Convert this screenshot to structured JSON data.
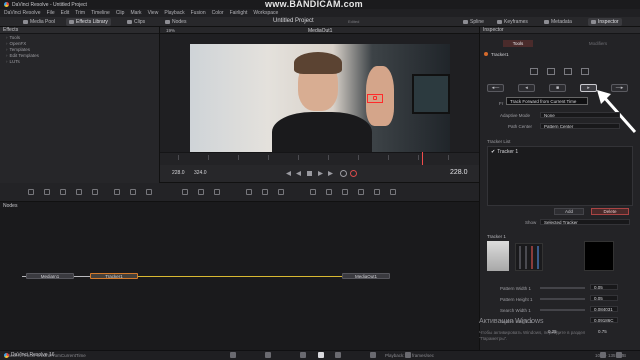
{
  "window": {
    "title": "DaVinci Resolve - Untitled Project",
    "watermark": "www.BANDICAM.com"
  },
  "menu": [
    "DaVinci Resolve",
    "File",
    "Edit",
    "Trim",
    "Timeline",
    "Clip",
    "Mark",
    "View",
    "Playback",
    "Fusion",
    "Color",
    "Fairlight",
    "Workspace"
  ],
  "toolbar": {
    "media_pool": "Media Pool",
    "effects_library": "Effects Library",
    "clips": "Clips",
    "nodes": "Nodes",
    "project_title": "Untitled Project",
    "edited": "Edited",
    "spline": "Spline",
    "keyframes": "Keyframes",
    "metadata": "Metadata",
    "inspector": "Inspector"
  },
  "effects": {
    "header": "Effects",
    "items": [
      "Tools",
      "OpenFX",
      "Templates",
      "Edit Templates",
      "LUTs"
    ]
  },
  "viewer": {
    "zoom": "19%",
    "name": "MediaOut1",
    "frame_start": "228.0",
    "frame_mid": "324.0",
    "frame_current": "228.0"
  },
  "nodes": {
    "header": "Nodes",
    "media_in": "MediaIn1",
    "tracker": "Tracker1",
    "media_out": "MediaOut1"
  },
  "inspector": {
    "header": "Inspector",
    "tab_tools": "Tools",
    "tab_modifiers": "Modifiers",
    "node_name": "Tracker1",
    "tooltip": "Track Forward from Current Time",
    "frames_label": "Fr",
    "adaptive_mode_label": "Adaptive Mode",
    "adaptive_mode_value": "None",
    "path_center_label": "Path Center",
    "path_center_value": "Pattern Center",
    "tracker_list_label": "Tracker List",
    "tracker_item": "Tracker 1",
    "add_button": "Add",
    "delete_button": "Delete",
    "show_label": "Show",
    "show_value": "Selected Tracker",
    "tracker_section": "Tracker 1",
    "params": [
      {
        "label": "Pattern Width 1",
        "value": "0.05"
      },
      {
        "label": "Pattern Height 1",
        "value": "0.05"
      },
      {
        "label": "Search Width 1",
        "value": "0.084031"
      },
      {
        "label": "Search Height 1",
        "value": "0.09186C"
      }
    ],
    "last_value_a": "0.25",
    "last_value_b": "0.75"
  },
  "activation": {
    "title": "Активация Windows",
    "line1": "Чтобы активировать Windows, перейдите в раздел",
    "line2": "\"Параметры\"."
  },
  "status": {
    "left": "Tracker1.TrackForwardFromCurrentTime",
    "playback": "Playback: 24 frames/sec",
    "memory": "10% - 1357 MB"
  },
  "taskbar": {
    "app_name": "DaVinci Resolve 16"
  }
}
